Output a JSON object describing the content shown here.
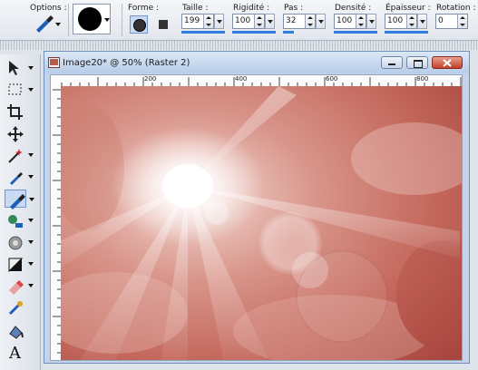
{
  "toolbar": {
    "options_label": "Options :",
    "forme_label": "Forme :",
    "taille_label": "Taille :",
    "taille_value": "199",
    "rigidite_label": "Rigidité :",
    "rigidite_value": "100",
    "pas_label": "Pas :",
    "pas_value": "32",
    "densite_label": "Densité :",
    "densite_value": "100",
    "epaisseur_label": "Épaisseur :",
    "epaisseur_value": "100",
    "rotation_label": "Rotation :",
    "rotation_value": "0"
  },
  "window": {
    "title": "Image20* @  50% (Raster 2)"
  },
  "ruler": {
    "ticks": [
      "200",
      "400",
      "600",
      "800"
    ]
  },
  "tools": [
    {
      "icon": "arrow-pointer-icon"
    },
    {
      "icon": "selection-rect-icon"
    },
    {
      "icon": "crop-icon"
    },
    {
      "icon": "move-icon"
    },
    {
      "icon": "magic-wand-icon"
    },
    {
      "icon": "dropper-icon"
    },
    {
      "icon": "paintbrush-icon"
    },
    {
      "icon": "clone-brush-icon"
    },
    {
      "icon": "scratch-remover-icon"
    },
    {
      "icon": "dodge-burn-icon"
    },
    {
      "icon": "eraser-icon"
    },
    {
      "icon": "picture-tube-icon"
    },
    {
      "icon": "fill-icon"
    },
    {
      "icon": "text-icon"
    }
  ],
  "colors": {
    "accent": "#2f7de1",
    "canvas_base": "#b85a50",
    "window_title": "#c4d4ea"
  }
}
